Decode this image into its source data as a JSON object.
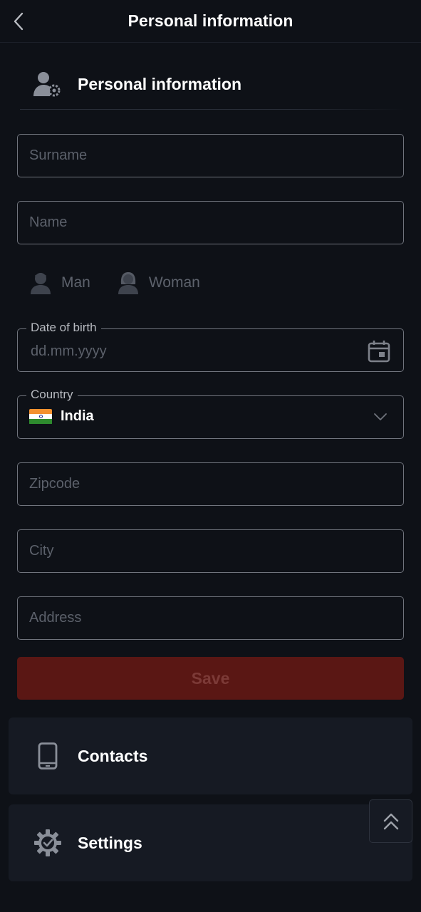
{
  "header": {
    "title": "Personal information",
    "back_icon": "chevron-left-icon"
  },
  "section": {
    "title": "Personal information",
    "icon": "user-settings-icon"
  },
  "form": {
    "surname": {
      "placeholder": "Surname",
      "value": ""
    },
    "name": {
      "placeholder": "Name",
      "value": ""
    },
    "gender": {
      "options": [
        {
          "label": "Man",
          "icon": "man-avatar-icon"
        },
        {
          "label": "Woman",
          "icon": "woman-avatar-icon"
        }
      ]
    },
    "dob": {
      "label": "Date of birth",
      "placeholder": "dd.mm.yyyy",
      "icon": "calendar-icon"
    },
    "country": {
      "label": "Country",
      "value": "India",
      "flag_icon": "india-flag-icon",
      "dropdown_icon": "chevron-down-icon"
    },
    "zipcode": {
      "placeholder": "Zipcode",
      "value": ""
    },
    "city": {
      "placeholder": "City",
      "value": ""
    },
    "address": {
      "placeholder": "Address",
      "value": ""
    },
    "save_label": "Save"
  },
  "cards": [
    {
      "label": "Contacts",
      "icon": "smartphone-icon"
    },
    {
      "label": "Settings",
      "icon": "gear-check-icon"
    }
  ],
  "scroll_top_icon": "double-chevron-up-icon",
  "colors": {
    "background": "#0e1117",
    "card": "#161a23",
    "input_border": "#70747d",
    "placeholder": "#5c616b",
    "save_bg": "#5a1714",
    "save_text": "#7c3a37",
    "icon_gray": "#8a8f99"
  }
}
